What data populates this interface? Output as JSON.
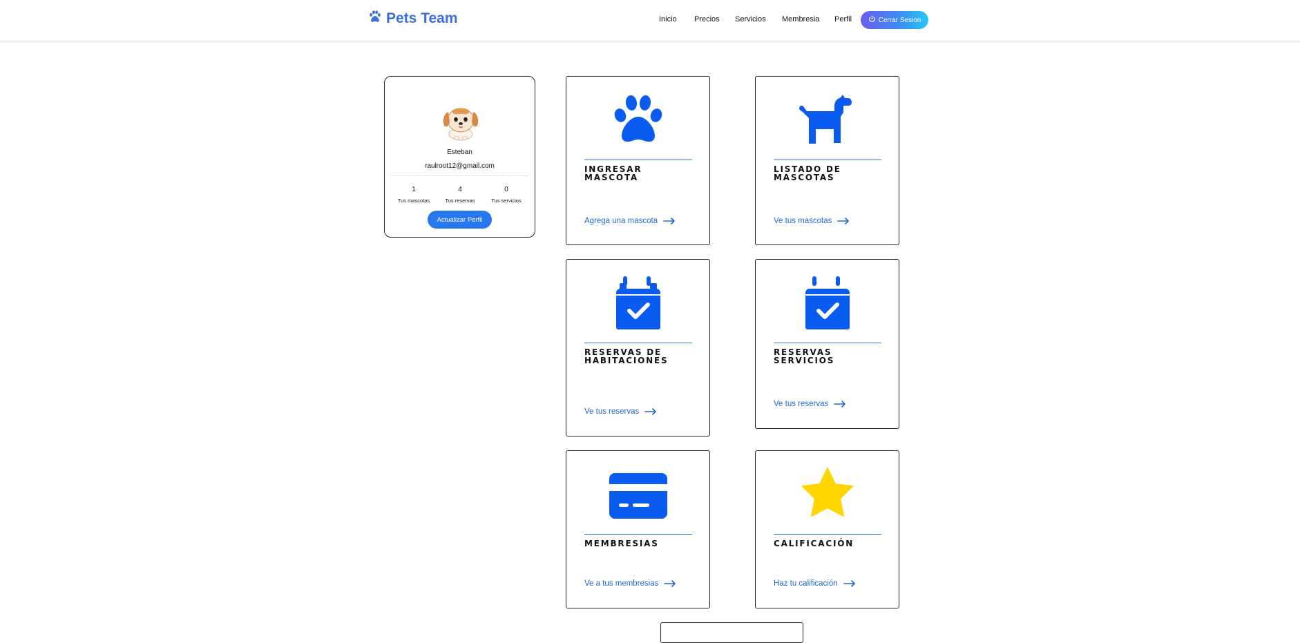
{
  "header": {
    "brand": "Pets Team",
    "nav": [
      "Inicio",
      "Precios",
      "Servicios",
      "Membresia",
      "Perfil"
    ],
    "logout_label": "Cerrar Sesion"
  },
  "profile": {
    "name": "Esteban",
    "email": "raulroot12@gmail.com",
    "stats": [
      {
        "value": "1",
        "label": "Tus mascotas"
      },
      {
        "value": "4",
        "label": "Tus reservas"
      },
      {
        "value": "0",
        "label": "Tus servicios"
      }
    ],
    "update_label": "Actualizar Perfil"
  },
  "cards": [
    {
      "title": "INGRESAR MASCOTA",
      "link": "Agrega una mascota",
      "icon": "paw-icon"
    },
    {
      "title": "LISTADO DE MASCOTAS",
      "link": "Ve tus mascotas",
      "icon": "dog-icon"
    },
    {
      "title": "RESERVAS DE HABITACIONES",
      "link": "Ve tus reservas",
      "icon": "calendar-check-icon"
    },
    {
      "title": "RESERVAS SERVICIOS",
      "link": "Ve tus reservas",
      "icon": "calendar-check-icon"
    },
    {
      "title": "MEMBRESIAS",
      "link": "Ve a tus membresias",
      "icon": "credit-card-icon"
    },
    {
      "title": "CALIFICACIÓN",
      "link": "Haz tu calificación",
      "icon": "star-icon"
    }
  ],
  "colors": {
    "accent": "#0a5bf0",
    "link": "#1f67d9",
    "star": "#ffd400",
    "brand": "#3a6fe0"
  }
}
